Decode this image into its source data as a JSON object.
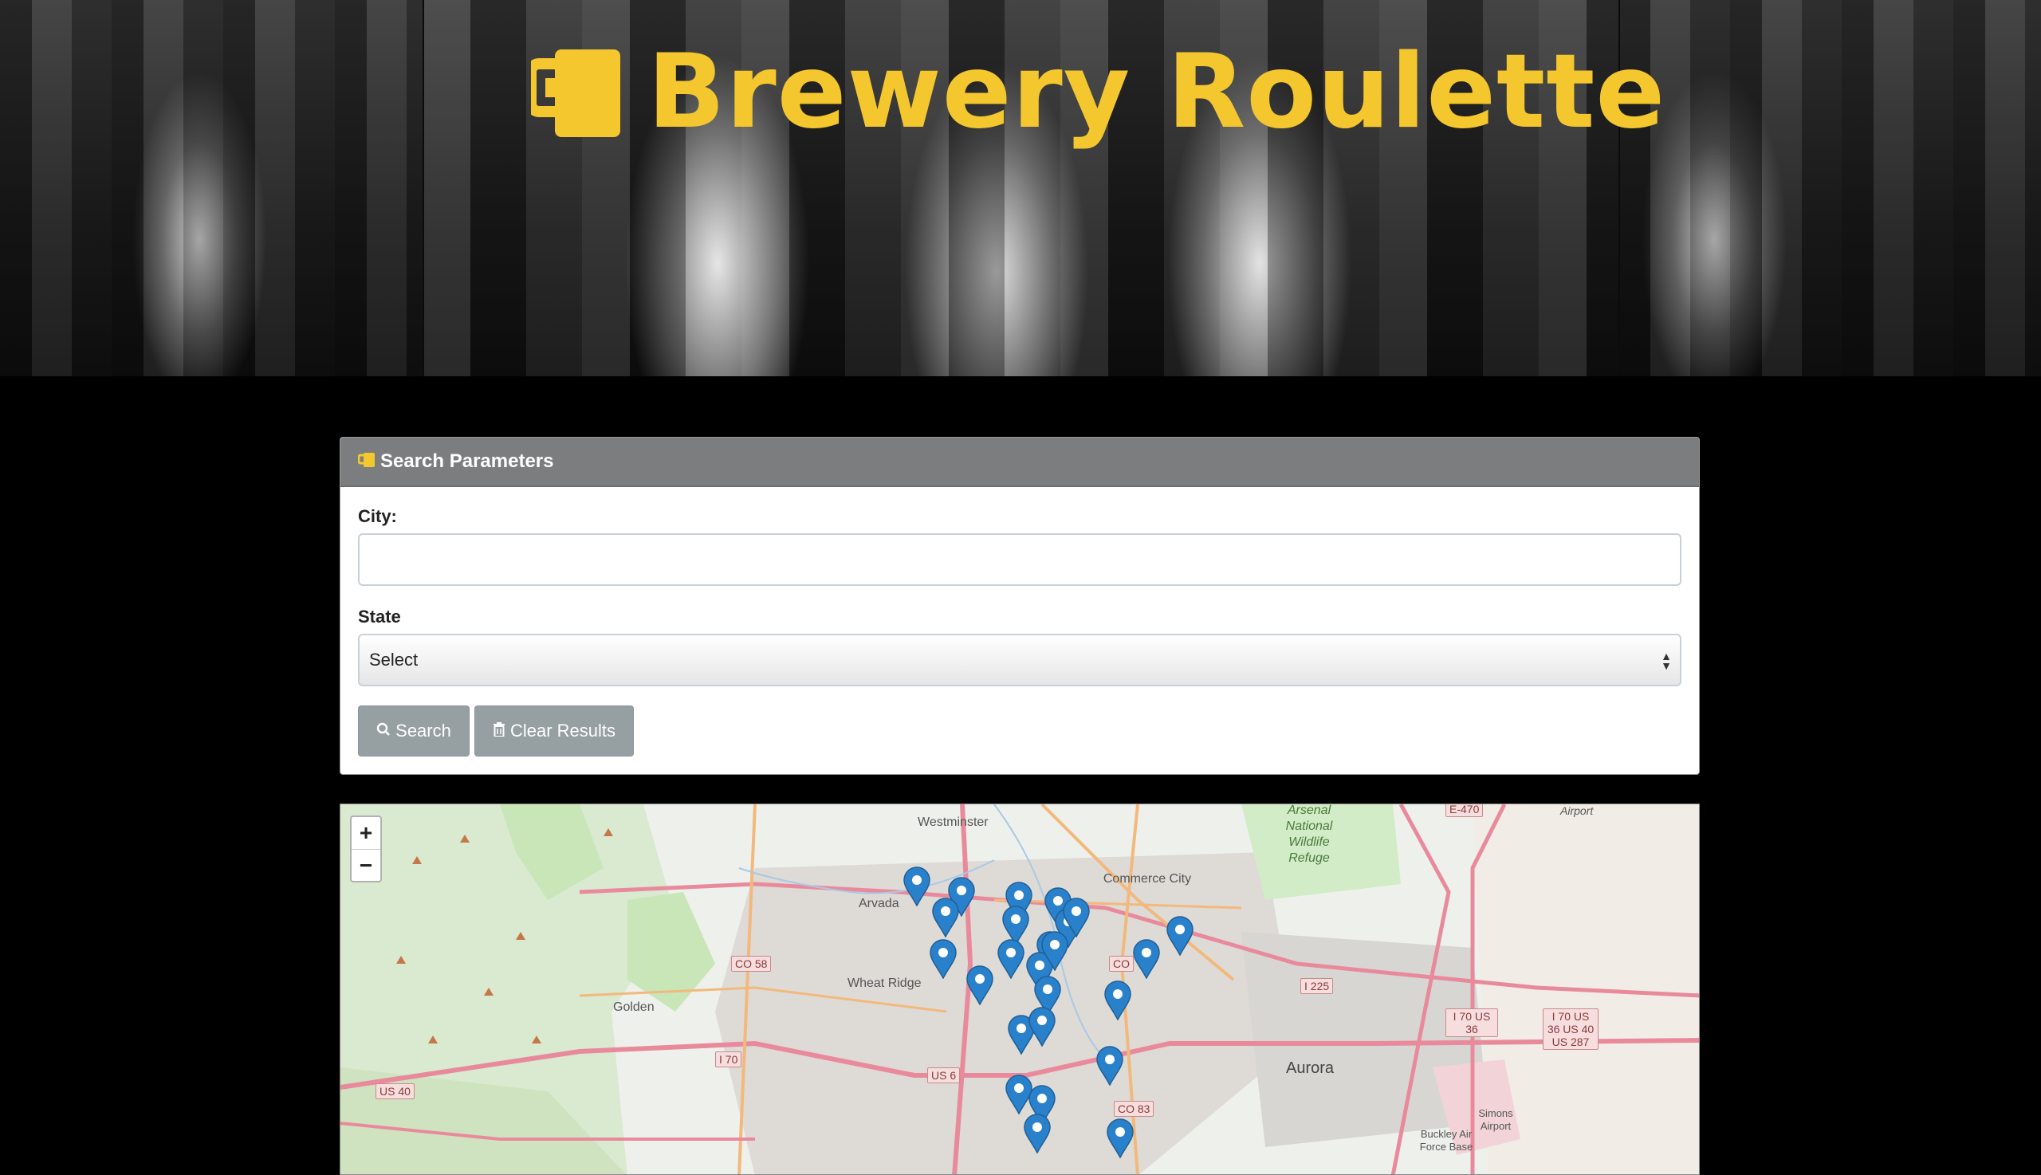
{
  "header": {
    "title": "Brewery Roulette",
    "icon": "beer-mug-icon",
    "accent_color": "#f5c72e"
  },
  "search_panel": {
    "heading": "Search Parameters",
    "icon": "beer-mug-icon",
    "city_label": "City:",
    "city_value": "",
    "state_label": "State",
    "state_selected": "Select",
    "search_button": "Search",
    "clear_button": "Clear Results"
  },
  "map": {
    "zoom_in": "+",
    "zoom_out": "−",
    "place_labels": [
      "Westminster",
      "Commerce City",
      "Arvada",
      "Wheat Ridge",
      "Golden",
      "Aurora",
      "Arsenal National Wildlife Refuge",
      "Buckley Air Force Base",
      "Simons Airport",
      "Airport"
    ],
    "road_labels": [
      "CO 58",
      "I 70",
      "US 6",
      "US 40",
      "CO 83",
      "I 225",
      "I 70 US 36",
      "I 70 US 36 US 40 US 287",
      "E-470",
      "CO"
    ],
    "marker_count": 30
  }
}
